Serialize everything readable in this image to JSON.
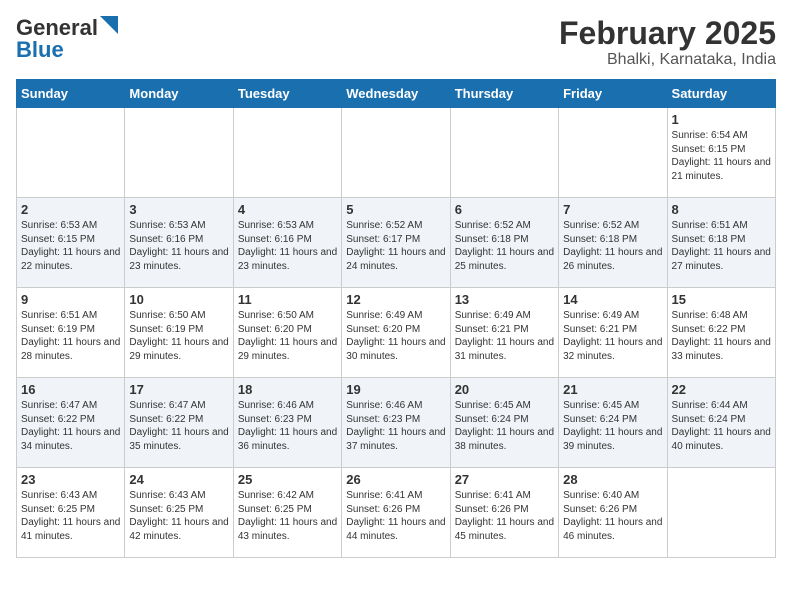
{
  "header": {
    "logo_general": "General",
    "logo_blue": "Blue",
    "month": "February 2025",
    "location": "Bhalki, Karnataka, India"
  },
  "days_of_week": [
    "Sunday",
    "Monday",
    "Tuesday",
    "Wednesday",
    "Thursday",
    "Friday",
    "Saturday"
  ],
  "weeks": [
    [
      {
        "day": "",
        "info": ""
      },
      {
        "day": "",
        "info": ""
      },
      {
        "day": "",
        "info": ""
      },
      {
        "day": "",
        "info": ""
      },
      {
        "day": "",
        "info": ""
      },
      {
        "day": "",
        "info": ""
      },
      {
        "day": "1",
        "info": "Sunrise: 6:54 AM\nSunset: 6:15 PM\nDaylight: 11 hours and 21 minutes."
      }
    ],
    [
      {
        "day": "2",
        "info": "Sunrise: 6:53 AM\nSunset: 6:15 PM\nDaylight: 11 hours and 22 minutes."
      },
      {
        "day": "3",
        "info": "Sunrise: 6:53 AM\nSunset: 6:16 PM\nDaylight: 11 hours and 23 minutes."
      },
      {
        "day": "4",
        "info": "Sunrise: 6:53 AM\nSunset: 6:16 PM\nDaylight: 11 hours and 23 minutes."
      },
      {
        "day": "5",
        "info": "Sunrise: 6:52 AM\nSunset: 6:17 PM\nDaylight: 11 hours and 24 minutes."
      },
      {
        "day": "6",
        "info": "Sunrise: 6:52 AM\nSunset: 6:18 PM\nDaylight: 11 hours and 25 minutes."
      },
      {
        "day": "7",
        "info": "Sunrise: 6:52 AM\nSunset: 6:18 PM\nDaylight: 11 hours and 26 minutes."
      },
      {
        "day": "8",
        "info": "Sunrise: 6:51 AM\nSunset: 6:18 PM\nDaylight: 11 hours and 27 minutes."
      }
    ],
    [
      {
        "day": "9",
        "info": "Sunrise: 6:51 AM\nSunset: 6:19 PM\nDaylight: 11 hours and 28 minutes."
      },
      {
        "day": "10",
        "info": "Sunrise: 6:50 AM\nSunset: 6:19 PM\nDaylight: 11 hours and 29 minutes."
      },
      {
        "day": "11",
        "info": "Sunrise: 6:50 AM\nSunset: 6:20 PM\nDaylight: 11 hours and 29 minutes."
      },
      {
        "day": "12",
        "info": "Sunrise: 6:49 AM\nSunset: 6:20 PM\nDaylight: 11 hours and 30 minutes."
      },
      {
        "day": "13",
        "info": "Sunrise: 6:49 AM\nSunset: 6:21 PM\nDaylight: 11 hours and 31 minutes."
      },
      {
        "day": "14",
        "info": "Sunrise: 6:49 AM\nSunset: 6:21 PM\nDaylight: 11 hours and 32 minutes."
      },
      {
        "day": "15",
        "info": "Sunrise: 6:48 AM\nSunset: 6:22 PM\nDaylight: 11 hours and 33 minutes."
      }
    ],
    [
      {
        "day": "16",
        "info": "Sunrise: 6:47 AM\nSunset: 6:22 PM\nDaylight: 11 hours and 34 minutes."
      },
      {
        "day": "17",
        "info": "Sunrise: 6:47 AM\nSunset: 6:22 PM\nDaylight: 11 hours and 35 minutes."
      },
      {
        "day": "18",
        "info": "Sunrise: 6:46 AM\nSunset: 6:23 PM\nDaylight: 11 hours and 36 minutes."
      },
      {
        "day": "19",
        "info": "Sunrise: 6:46 AM\nSunset: 6:23 PM\nDaylight: 11 hours and 37 minutes."
      },
      {
        "day": "20",
        "info": "Sunrise: 6:45 AM\nSunset: 6:24 PM\nDaylight: 11 hours and 38 minutes."
      },
      {
        "day": "21",
        "info": "Sunrise: 6:45 AM\nSunset: 6:24 PM\nDaylight: 11 hours and 39 minutes."
      },
      {
        "day": "22",
        "info": "Sunrise: 6:44 AM\nSunset: 6:24 PM\nDaylight: 11 hours and 40 minutes."
      }
    ],
    [
      {
        "day": "23",
        "info": "Sunrise: 6:43 AM\nSunset: 6:25 PM\nDaylight: 11 hours and 41 minutes."
      },
      {
        "day": "24",
        "info": "Sunrise: 6:43 AM\nSunset: 6:25 PM\nDaylight: 11 hours and 42 minutes."
      },
      {
        "day": "25",
        "info": "Sunrise: 6:42 AM\nSunset: 6:25 PM\nDaylight: 11 hours and 43 minutes."
      },
      {
        "day": "26",
        "info": "Sunrise: 6:41 AM\nSunset: 6:26 PM\nDaylight: 11 hours and 44 minutes."
      },
      {
        "day": "27",
        "info": "Sunrise: 6:41 AM\nSunset: 6:26 PM\nDaylight: 11 hours and 45 minutes."
      },
      {
        "day": "28",
        "info": "Sunrise: 6:40 AM\nSunset: 6:26 PM\nDaylight: 11 hours and 46 minutes."
      },
      {
        "day": "",
        "info": ""
      }
    ]
  ]
}
